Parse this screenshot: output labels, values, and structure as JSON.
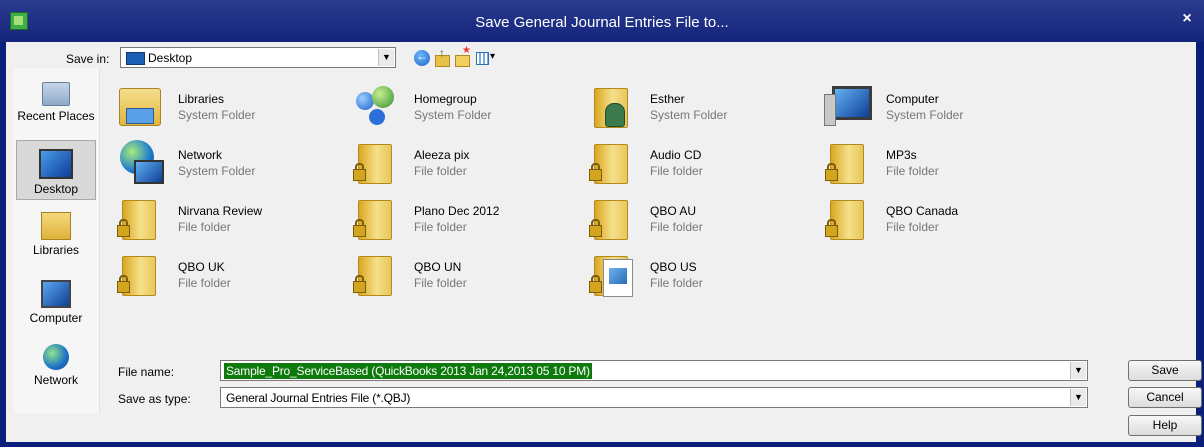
{
  "window": {
    "title": "Save General Journal Entries File to...",
    "close_glyph": "×"
  },
  "toolbar": {
    "save_in_label": "Save in:",
    "save_in_value": "Desktop"
  },
  "places": [
    {
      "label": "Recent Places",
      "icon": "recent-places-icon"
    },
    {
      "label": "Desktop",
      "icon": "desktop-icon",
      "selected": true
    },
    {
      "label": "Libraries",
      "icon": "libraries-icon"
    },
    {
      "label": "Computer",
      "icon": "computer-icon"
    },
    {
      "label": "Network",
      "icon": "network-icon"
    }
  ],
  "items": [
    {
      "name": "Libraries",
      "type": "System Folder",
      "icon": "libraries-icon"
    },
    {
      "name": "Homegroup",
      "type": "System Folder",
      "icon": "homegroup-icon"
    },
    {
      "name": "Esther",
      "type": "System Folder",
      "icon": "user-folder-icon"
    },
    {
      "name": "Computer",
      "type": "System Folder",
      "icon": "computer-icon"
    },
    {
      "name": "Network",
      "type": "System Folder",
      "icon": "network-icon"
    },
    {
      "name": "Aleeza pix",
      "type": "File folder",
      "icon": "locked-folder-icon"
    },
    {
      "name": "Audio CD",
      "type": "File folder",
      "icon": "locked-folder-icon"
    },
    {
      "name": "MP3s",
      "type": "File folder",
      "icon": "locked-folder-icon"
    },
    {
      "name": "Nirvana Review",
      "type": "File folder",
      "icon": "locked-folder-icon"
    },
    {
      "name": "Plano Dec 2012",
      "type": "File folder",
      "icon": "locked-folder-icon"
    },
    {
      "name": "QBO AU",
      "type": "File folder",
      "icon": "locked-folder-icon"
    },
    {
      "name": "QBO Canada",
      "type": "File folder",
      "icon": "locked-folder-icon"
    },
    {
      "name": "QBO UK",
      "type": "File folder",
      "icon": "locked-folder-icon"
    },
    {
      "name": "QBO UN",
      "type": "File folder",
      "icon": "locked-folder-icon"
    },
    {
      "name": "QBO US",
      "type": "File folder",
      "icon": "locked-folder-with-document-icon"
    }
  ],
  "form": {
    "file_name_label": "File name:",
    "file_name_value": "Sample_Pro_ServiceBased (QuickBooks 2013 Jan 24,2013  05 10 PM)",
    "save_type_label": "Save as type:",
    "save_type_value": "General Journal Entries File (*.QBJ)"
  },
  "buttons": {
    "save": "Save",
    "cancel": "Cancel",
    "help": "Help"
  },
  "colors": {
    "title_bar": "#1a2a80",
    "selection": "#0e7a0d"
  }
}
